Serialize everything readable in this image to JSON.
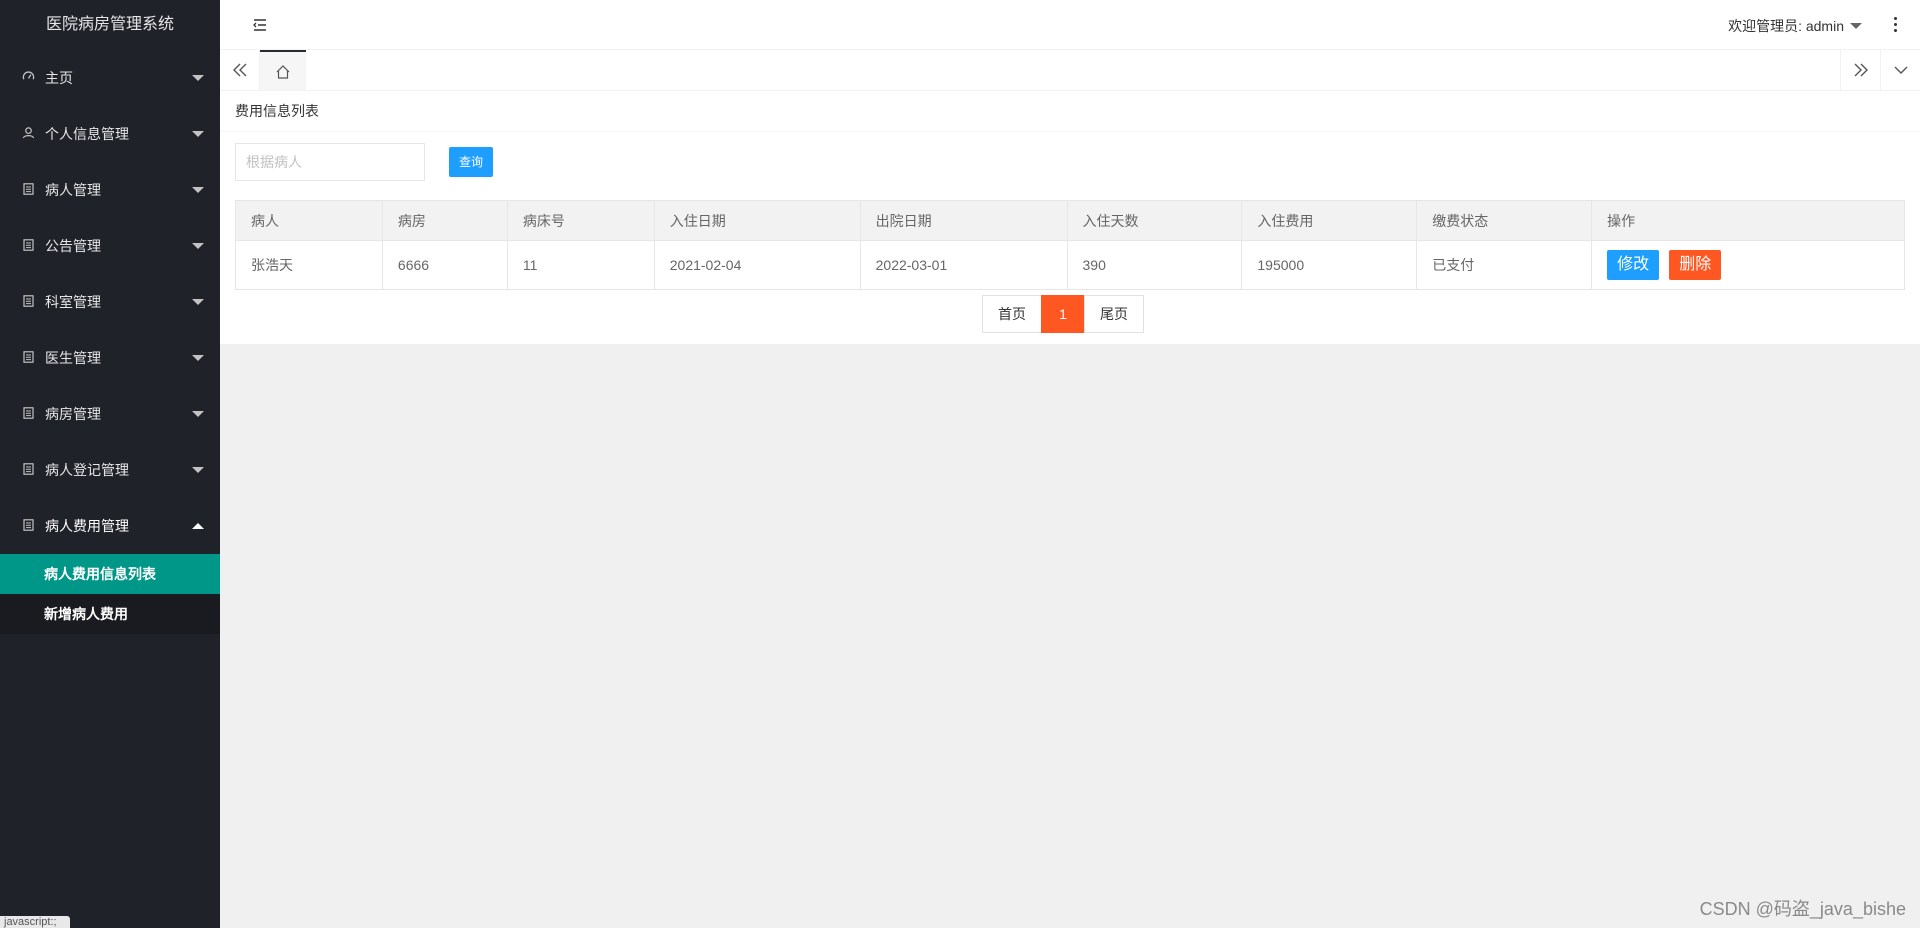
{
  "app": {
    "title": "医院病房管理系统"
  },
  "sidebar": {
    "items": [
      {
        "label": "主页",
        "icon": "dashboard-icon"
      },
      {
        "label": "个人信息管理",
        "icon": "user-icon"
      },
      {
        "label": "病人管理",
        "icon": "document-icon"
      },
      {
        "label": "公告管理",
        "icon": "document-icon"
      },
      {
        "label": "科室管理",
        "icon": "document-icon"
      },
      {
        "label": "医生管理",
        "icon": "document-icon"
      },
      {
        "label": "病房管理",
        "icon": "document-icon"
      },
      {
        "label": "病人登记管理",
        "icon": "document-icon"
      },
      {
        "label": "病人费用管理",
        "icon": "document-icon"
      }
    ],
    "subitems": [
      {
        "label": "病人费用信息列表",
        "active": true
      },
      {
        "label": "新增病人费用",
        "active": false
      }
    ],
    "status_tip": "javascript:;"
  },
  "header": {
    "user_label": "欢迎管理员: admin"
  },
  "card": {
    "title": "费用信息列表",
    "search_placeholder": "根据病人",
    "search_value": "",
    "query_label": "查询"
  },
  "table": {
    "columns": [
      "病人",
      "病房",
      "病床号",
      "入住日期",
      "出院日期",
      "入住天数",
      "入住费用",
      "缴费状态",
      "操作"
    ],
    "rows": [
      {
        "patient": "张浩天",
        "ward": "6666",
        "bed": "11",
        "checkin": "2021-02-04",
        "checkout": "2022-03-01",
        "days": "390",
        "cost": "195000",
        "status": "已支付",
        "edit_label": "修改",
        "delete_label": "删除"
      }
    ]
  },
  "pager": {
    "first": "首页",
    "current": "1",
    "last": "尾页"
  },
  "watermark": "CSDN @码盗_java_bishe",
  "colors": {
    "sidebar_bg": "#20222a",
    "active_green": "#009688",
    "primary_blue": "#1e9fff",
    "danger_orange": "#ff5722"
  }
}
